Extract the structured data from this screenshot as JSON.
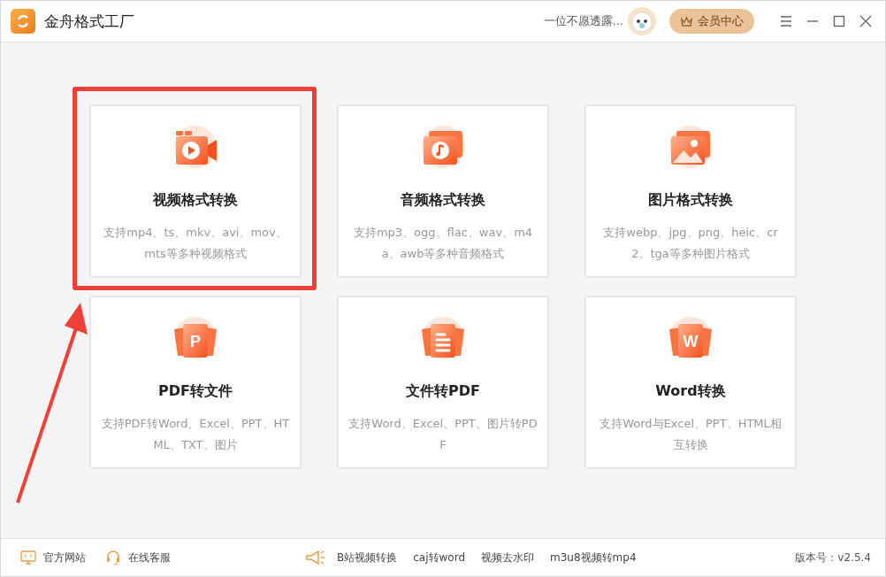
{
  "app": {
    "title": "金舟格式工厂"
  },
  "user": {
    "name": "一位不愿透露..."
  },
  "vip_button": {
    "label": "会员中心"
  },
  "cards": [
    {
      "kind": "video",
      "title": "视频格式转换",
      "description": "支持mp4、ts、mkv、avi、mov、mts等多种视频格式",
      "highlighted": true
    },
    {
      "kind": "audio",
      "title": "音频格式转换",
      "description": "支持mp3、ogg、flac、wav、m4a、awb等多种音频格式",
      "highlighted": false
    },
    {
      "kind": "image",
      "title": "图片格式转换",
      "description": "支持webp、jpg、png、heic、cr2、tga等多种图片格式",
      "highlighted": false
    },
    {
      "kind": "pdf",
      "icon_glyph": "P",
      "title": "PDF转文件",
      "description": "支持PDF转Word、Excel、PPT、HTML、TXT、图片",
      "highlighted": false
    },
    {
      "kind": "document",
      "title": "文件转PDF",
      "description": "支持Word、Excel、PPT、图片转PDF",
      "highlighted": false
    },
    {
      "kind": "word",
      "icon_glyph": "W",
      "title": "Word转换",
      "description": "支持Word与Excel、PPT、HTML相互转换",
      "highlighted": false
    }
  ],
  "footer": {
    "links": [
      {
        "kind": "website",
        "label": "官方网站"
      },
      {
        "kind": "support",
        "label": "在线客服"
      }
    ],
    "tools": [
      "B站视频转换",
      "caj转word",
      "视频去水印",
      "m3u8视频转mp4"
    ],
    "version": "版本号：v2.5.4"
  }
}
